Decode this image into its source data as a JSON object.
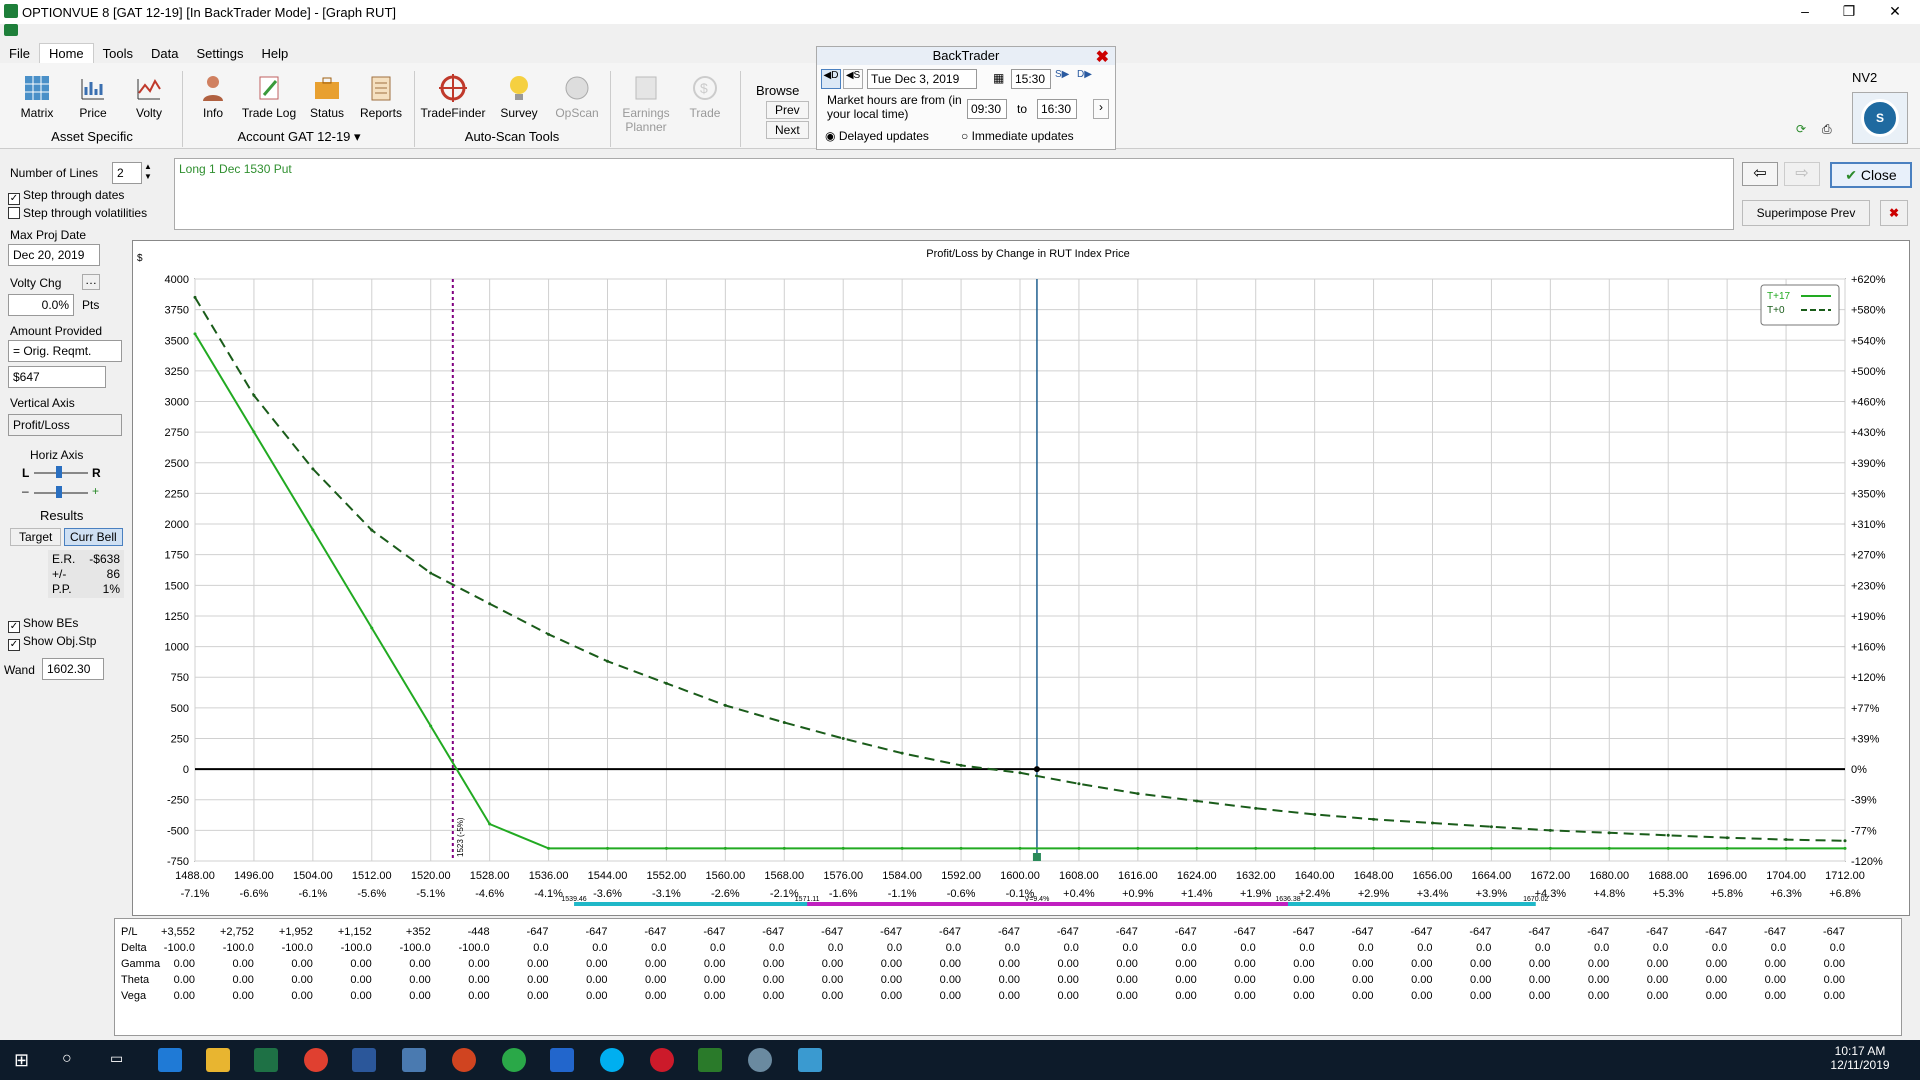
{
  "window": {
    "title": "OPTIONVUE 8   [GAT 12-19]   [In BackTrader Mode] - [Graph RUT]",
    "min": "–",
    "max": "❐",
    "close": "✕"
  },
  "menu": [
    "File",
    "Home",
    "Tools",
    "Data",
    "Settings",
    "Help"
  ],
  "ribbon": {
    "buttons": [
      "Matrix",
      "Price",
      "Volty",
      "Info",
      "Trade Log",
      "Status",
      "Reports",
      "TradeFinder",
      "Survey",
      "OpScan",
      "Earnings Planner",
      "Trade"
    ],
    "groups": {
      "asset": "Asset Specific",
      "account": "Account GAT 12-19 ▾",
      "autoscan": "Auto-Scan Tools"
    },
    "browse": {
      "label": "Browse",
      "prev": "Prev",
      "next": "Next"
    }
  },
  "backtrader": {
    "title": "BackTrader",
    "date": "Tue Dec 3, 2019",
    "time": "15:30",
    "market_label": "Market hours are from (in your local time)",
    "from": "09:30",
    "to_label": "to",
    "to": "16:30",
    "delayed": "Delayed updates",
    "immediate": "Immediate updates"
  },
  "right": {
    "nv2": "NV2",
    "close": "Close",
    "superimpose": "Superimpose Prev"
  },
  "left": {
    "num_lines_label": "Number of Lines",
    "num_lines": "2",
    "step_dates": "Step through dates",
    "step_vols": "Step through volatilities",
    "max_proj_label": "Max Proj Date",
    "max_proj": "Dec 20, 2019",
    "volty_label": "Volty Chg",
    "volty": "0.0%",
    "pts": "Pts",
    "amount_label": "Amount Provided",
    "amount_sel": "= Orig. Reqmt.",
    "amount": "$647",
    "vaxis_label": "Vertical Axis",
    "vaxis": "Profit/Loss",
    "haxis_label": "Horiz Axis",
    "results": "Results",
    "target": "Target",
    "currbell": "Curr Bell",
    "er_l": "E.R.",
    "er": "-$638",
    "pm_l": "+/-",
    "pm": "86",
    "pp_l": "P.P.",
    "pp": "1%",
    "show_bes": "Show BEs",
    "show_obj": "Show Obj.Stp",
    "wand_label": "Wand",
    "wand": "1602.30"
  },
  "notes": "Long 1 Dec 1530 Put",
  "chart_data": {
    "type": "line",
    "title": "Profit/Loss by Change in RUT Index Price",
    "ylabel": "$",
    "ylim": [
      -750,
      4000
    ],
    "x": [
      1488,
      1496,
      1504,
      1512,
      1520,
      1528,
      1536,
      1544,
      1552,
      1560,
      1568,
      1576,
      1584,
      1592,
      1600,
      1608,
      1616,
      1624,
      1632,
      1640,
      1648,
      1656,
      1664,
      1672,
      1680,
      1688,
      1696,
      1704,
      1712
    ],
    "xticks": [
      "1488.00",
      "1496.00",
      "1504.00",
      "1512.00",
      "1520.00",
      "1528.00",
      "1536.00",
      "1544.00",
      "1552.00",
      "1560.00",
      "1568.00",
      "1576.00",
      "1584.00",
      "1592.00",
      "1600.00",
      "1608.00",
      "1616.00",
      "1624.00",
      "1632.00",
      "1640.00",
      "1648.00",
      "1656.00",
      "1664.00",
      "1672.00",
      "1680.00",
      "1688.00",
      "1696.00",
      "1704.00",
      "1712.00"
    ],
    "xpct": [
      "-7.1%",
      "-6.6%",
      "-6.1%",
      "-5.6%",
      "-5.1%",
      "-4.6%",
      "-4.1%",
      "-3.6%",
      "-3.1%",
      "-2.6%",
      "-2.1%",
      "-1.6%",
      "-1.1%",
      "-0.6%",
      "-0.1%",
      "+0.4%",
      "+0.9%",
      "+1.4%",
      "+1.9%",
      "+2.4%",
      "+2.9%",
      "+3.4%",
      "+3.9%",
      "+4.3%",
      "+4.8%",
      "+5.3%",
      "+5.8%",
      "+6.3%",
      "+6.8%"
    ],
    "yticks": [
      4000,
      3750,
      3500,
      3250,
      3000,
      2750,
      2500,
      2250,
      2000,
      1750,
      1500,
      1250,
      1000,
      750,
      500,
      250,
      0,
      -250,
      -500,
      -750
    ],
    "ypct": [
      "+620%",
      "+580%",
      "+540%",
      "+500%",
      "+460%",
      "+430%",
      "+390%",
      "+350%",
      "+310%",
      "+270%",
      "+230%",
      "+190%",
      "+160%",
      "+120%",
      "+77%",
      "+39%",
      "0%",
      "-39%",
      "-77%",
      "-120%"
    ],
    "series": [
      {
        "name": "T+17",
        "style": "solid",
        "color": "#22aa22",
        "values": [
          3552,
          2752,
          1952,
          1152,
          352,
          -448,
          -647,
          -647,
          -647,
          -647,
          -647,
          -647,
          -647,
          -647,
          -647,
          -647,
          -647,
          -647,
          -647,
          -647,
          -647,
          -647,
          -647,
          -647,
          -647,
          -647,
          -647,
          -647,
          -647
        ]
      },
      {
        "name": "T+0",
        "style": "dashed",
        "color": "#1a5c1a",
        "values": [
          3850,
          3050,
          2450,
          1950,
          1600,
          1350,
          1100,
          880,
          700,
          520,
          380,
          250,
          130,
          30,
          -30,
          -120,
          -200,
          -260,
          -320,
          -370,
          -410,
          -440,
          -470,
          -500,
          -520,
          -540,
          -560,
          -575,
          -585
        ]
      }
    ],
    "breakeven": 1523,
    "breakeven_label": "1523 (-5%)",
    "current": 1602.3,
    "bell": {
      "labels": [
        "1539.46",
        "1571.11",
        "V=9.4%",
        "1636.38",
        "1670.02"
      ]
    },
    "colors": {
      "grid": "#d0d0d0",
      "breakeven": "#800080",
      "current": "#1f5f8f"
    }
  },
  "table": {
    "row_labels": [
      "P/L",
      "Delta",
      "Gamma",
      "Theta",
      "Vega"
    ],
    "pl": [
      "+3,552",
      "+2,752",
      "+1,952",
      "+1,152",
      "+352",
      "-448",
      "-647",
      "-647",
      "-647",
      "-647",
      "-647",
      "-647",
      "-647",
      "-647",
      "-647",
      "-647",
      "-647",
      "-647",
      "-647",
      "-647",
      "-647",
      "-647",
      "-647",
      "-647",
      "-647",
      "-647",
      "-647",
      "-647",
      "-647"
    ],
    "delta": [
      "-100.0",
      "-100.0",
      "-100.0",
      "-100.0",
      "-100.0",
      "-100.0",
      "0.0",
      "0.0",
      "0.0",
      "0.0",
      "0.0",
      "0.0",
      "0.0",
      "0.0",
      "0.0",
      "0.0",
      "0.0",
      "0.0",
      "0.0",
      "0.0",
      "0.0",
      "0.0",
      "0.0",
      "0.0",
      "0.0",
      "0.0",
      "0.0",
      "0.0",
      "0.0"
    ],
    "zero": "0.00"
  },
  "taskbar": {
    "time": "10:17 AM",
    "date": "12/11/2019"
  }
}
